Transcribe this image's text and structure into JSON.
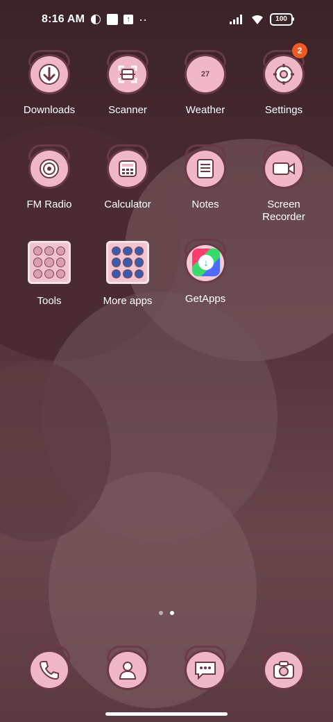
{
  "status_bar": {
    "time": "8:16 AM",
    "battery": "100"
  },
  "apps": [
    {
      "label": "Downloads",
      "icon": "download-icon"
    },
    {
      "label": "Scanner",
      "icon": "scanner-icon"
    },
    {
      "label": "Weather",
      "icon": "weather-icon",
      "glyph_text": "27"
    },
    {
      "label": "Settings",
      "icon": "gear-icon",
      "badge": "2"
    },
    {
      "label": "FM Radio",
      "icon": "radio-icon"
    },
    {
      "label": "Calculator",
      "icon": "calculator-icon"
    },
    {
      "label": "Notes",
      "icon": "notes-icon"
    },
    {
      "label": "Screen Recorder",
      "label_line1": "Screen",
      "label_line2": "Recorder",
      "icon": "video-camera-icon"
    },
    {
      "label": "Tools",
      "icon": "folder-icon"
    },
    {
      "label": "More apps",
      "icon": "folder-icon"
    },
    {
      "label": "GetApps",
      "icon": "getapps-icon"
    }
  ],
  "dock": [
    {
      "icon": "phone-icon"
    },
    {
      "icon": "contacts-icon"
    },
    {
      "icon": "messages-icon"
    },
    {
      "icon": "camera-icon"
    }
  ],
  "colors": {
    "icon_fill": "#f0b8c6",
    "icon_outline": "#6b3a44",
    "badge": "#f15a24"
  }
}
